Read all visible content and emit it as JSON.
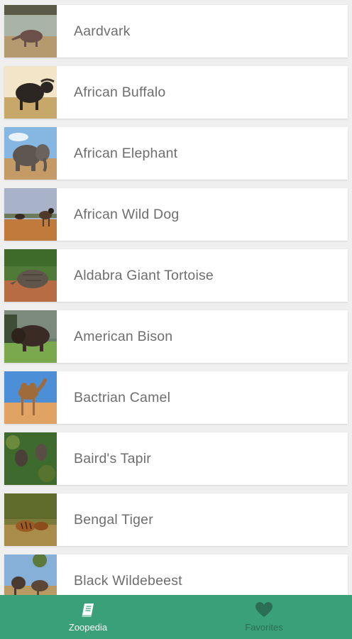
{
  "animals": [
    {
      "name": "Aardvark",
      "thumb": {
        "sky": "#a9b3a6",
        "ground": "#b49a6e",
        "body": "#6a5048",
        "scene": "aardvark"
      }
    },
    {
      "name": "African Buffalo",
      "thumb": {
        "sky": "#f2e5c8",
        "ground": "#c8a76a",
        "body": "#2c2622",
        "scene": "buffalo"
      }
    },
    {
      "name": "African Elephant",
      "thumb": {
        "sky": "#86b6e2",
        "ground": "#c49a66",
        "body": "#5d5650",
        "scene": "elephant"
      }
    },
    {
      "name": "African Wild Dog",
      "thumb": {
        "sky": "#a8b2c8",
        "ground": "#c07a3c",
        "body": "#4f3a2a",
        "scene": "wilddog"
      }
    },
    {
      "name": "Aldabra Giant Tortoise",
      "thumb": {
        "sky": "#4f7a37",
        "ground": "#b86c43",
        "body": "#5f554b",
        "scene": "tortoise"
      }
    },
    {
      "name": "American Bison",
      "thumb": {
        "sky": "#6c7c6c",
        "ground": "#7aa84c",
        "body": "#3a2c24",
        "scene": "bison"
      }
    },
    {
      "name": "Bactrian Camel",
      "thumb": {
        "sky": "#4d8fd6",
        "ground": "#e0a363",
        "body": "#a06b3b",
        "scene": "camel"
      }
    },
    {
      "name": "Baird's Tapir",
      "thumb": {
        "sky": "#3e6a2d",
        "ground": "#2f5a23",
        "body": "#4a4038",
        "scene": "tapir"
      }
    },
    {
      "name": "Bengal Tiger",
      "thumb": {
        "sky": "#7b7a3a",
        "ground": "#a98b4a",
        "body": "#9a5a22",
        "scene": "tiger"
      }
    },
    {
      "name": "Black Wildebeest",
      "thumb": {
        "sky": "#86b0d8",
        "ground": "#b89a62",
        "body": "#4a3a30",
        "scene": "wildebeest"
      }
    }
  ],
  "nav": {
    "zoopedia": {
      "label": "Zoopedia",
      "icon": "book-icon"
    },
    "favorites": {
      "label": "Favorites",
      "icon": "heart-icon"
    }
  },
  "colors": {
    "nav_background": "#3aa079",
    "nav_active": "#ffffff",
    "nav_inactive": "#2a6f55",
    "row_text": "#6e6e6e",
    "list_background": "#efefef"
  }
}
